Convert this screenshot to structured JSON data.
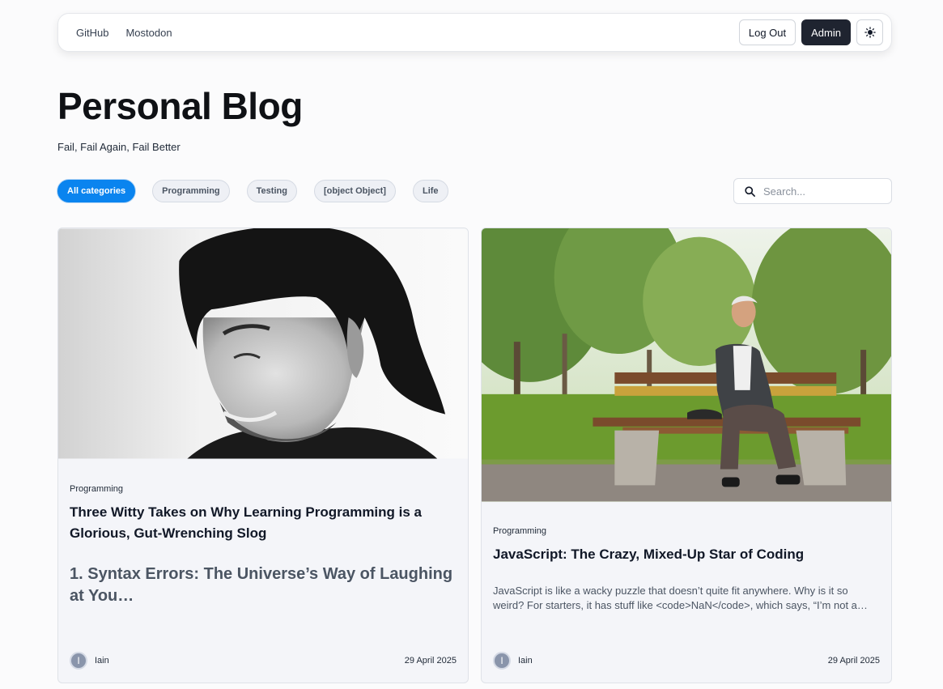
{
  "nav": {
    "links": [
      "GitHub",
      "Mostodon"
    ],
    "logout_label": "Log Out",
    "admin_label": "Admin",
    "theme_icon": "sun-icon"
  },
  "header": {
    "title": "Personal Blog",
    "subtitle": "Fail, Fail Again, Fail Better"
  },
  "categories": {
    "items": [
      "All categories",
      "Programming",
      "Testing",
      "[object Object]",
      "Life"
    ],
    "active": "All categories"
  },
  "search": {
    "placeholder": "Search..."
  },
  "posts": [
    {
      "category": "Programming",
      "title": "Three Witty Takes on Why Learning Programming is a Glorious, Gut-Wrenching Slog",
      "excerpt_heading": "1. Syntax Errors: The Universe’s Way of Laughing at You…",
      "author": "Iain",
      "avatar_letter": "I",
      "date": "29 April 2025"
    },
    {
      "category": "Programming",
      "title": "JavaScript: The Crazy, Mixed-Up Star of Coding",
      "excerpt": "JavaScript is like a wacky puzzle that doesn’t quite fit anywhere. Why is it so weird? For starters, it has stuff like <code>NaN</code>, which says, “I’m not a number” even though it is one.",
      "author": "Iain",
      "avatar_letter": "I",
      "date": "29 April 2025"
    }
  ],
  "colors": {
    "accent": "#0a84ef",
    "admin_button": "#1f2430"
  }
}
